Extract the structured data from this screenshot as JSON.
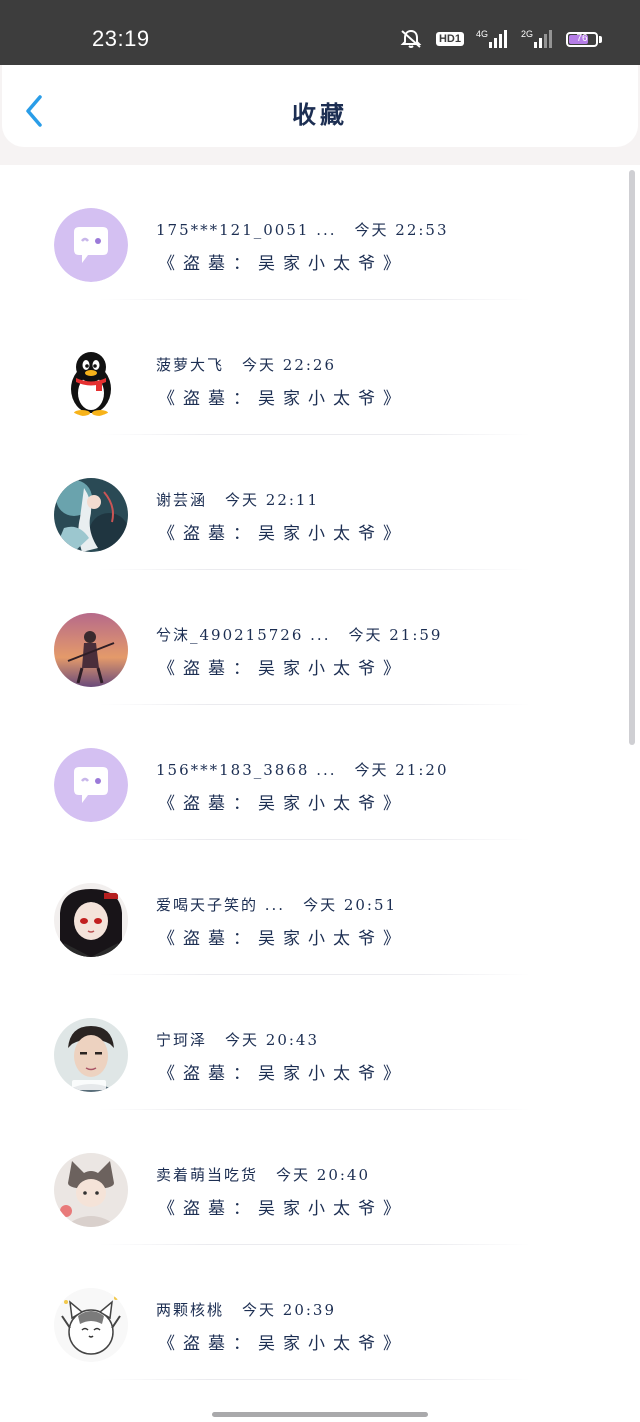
{
  "status_bar": {
    "time": "23:19",
    "hd_label": "HD1",
    "net1_label": "4G",
    "net2_label": "2G",
    "battery_text": "76",
    "battery_level": 0.76,
    "icons": [
      "mute-bell-icon",
      "hd-icon",
      "signal-4g-icon",
      "signal-2g-icon",
      "battery-icon"
    ]
  },
  "header": {
    "title": "收藏",
    "back_icon": "chevron-left-icon"
  },
  "colors": {
    "accent": "#2a9de8",
    "text": "#1c2e52",
    "status_bg": "#3d3d3d",
    "battery": "#b57de6"
  },
  "items": [
    {
      "name": "175***121_0051 ...",
      "time": "今天 22:53",
      "work": "《盗墓：吴家小太爷》",
      "avatar": "purple-chat-avatar"
    },
    {
      "name": "菠萝大飞",
      "time": "今天 22:26",
      "work": "《盗墓：吴家小太爷》",
      "avatar": "qq-penguin-avatar"
    },
    {
      "name": "谢芸涵",
      "time": "今天 22:11",
      "work": "《盗墓：吴家小太爷》",
      "avatar": "anime-art-avatar"
    },
    {
      "name": "兮沫_490215726 ...",
      "time": "今天 21:59",
      "work": "《盗墓：吴家小太爷》",
      "avatar": "sunset-figure-avatar"
    },
    {
      "name": "156***183_3868 ...",
      "time": "今天 21:20",
      "work": "《盗墓：吴家小太爷》",
      "avatar": "purple-chat-avatar"
    },
    {
      "name": "爱喝天子笑的 ...",
      "time": "今天 20:51",
      "work": "《盗墓：吴家小太爷》",
      "avatar": "anime-red-eyes-avatar"
    },
    {
      "name": "宁珂泽",
      "time": "今天 20:43",
      "work": "《盗墓：吴家小太爷》",
      "avatar": "young-man-photo-avatar"
    },
    {
      "name": "卖着萌当吃货",
      "time": "今天 20:40",
      "work": "《盗墓：吴家小太爷》",
      "avatar": "cat-hat-child-avatar"
    },
    {
      "name": "两颗核桃",
      "time": "今天 20:39",
      "work": "《盗墓：吴家小太爷》",
      "avatar": "cartoon-cat-avatar"
    }
  ]
}
